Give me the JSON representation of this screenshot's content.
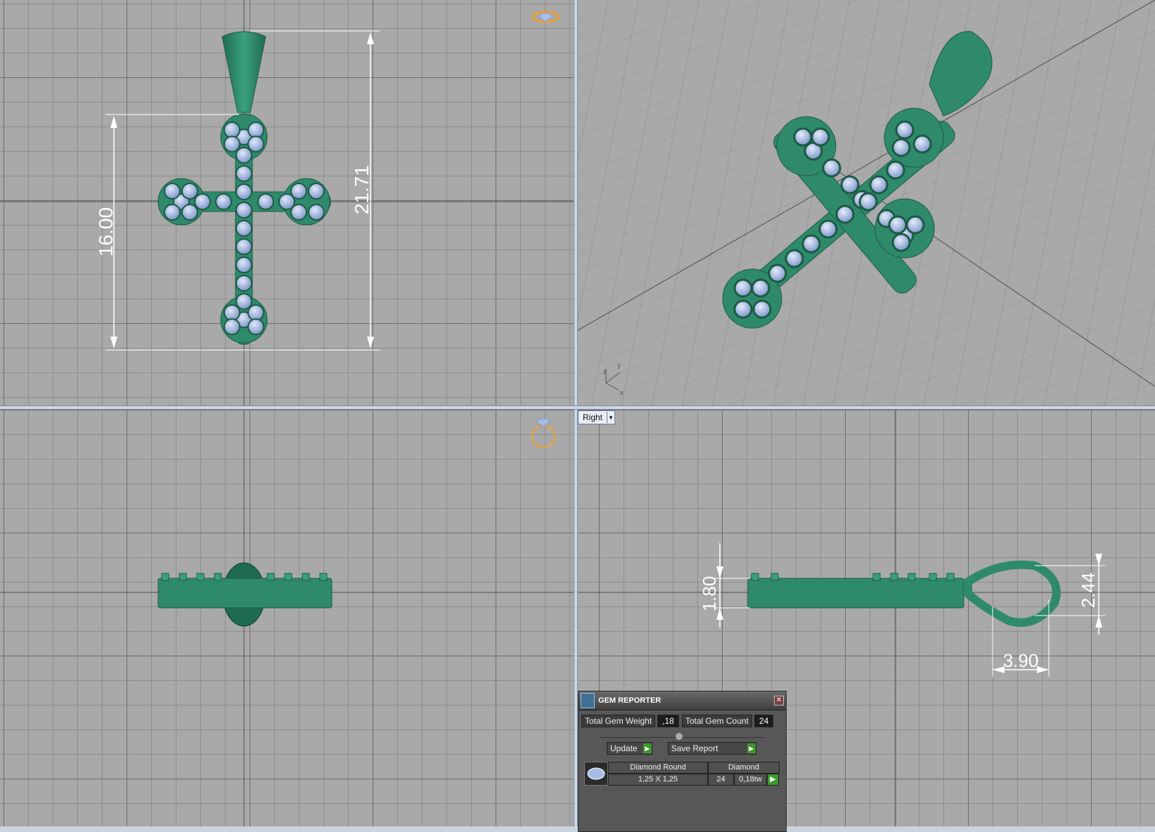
{
  "viewports": {
    "top": {
      "dimensions": [
        "16.00",
        "21.71"
      ]
    },
    "right": {
      "label": "Right",
      "dimensions": [
        "1.80",
        "2.44",
        "3.90"
      ]
    }
  },
  "axes": {
    "z": "z",
    "y": "y",
    "x": "x"
  },
  "gem_reporter": {
    "title": "GEM REPORTER",
    "total_weight_label": "Total Gem Weight",
    "total_weight_value": ",18",
    "total_count_label": "Total Gem Count",
    "total_count_value": "24",
    "update_label": "Update",
    "save_label": "Save Report",
    "table": {
      "shape_name": "Diamond Round",
      "material": "Diamond",
      "size": "1,25 X 1,25",
      "count": "24",
      "weight": "0,18tw"
    }
  },
  "colors": {
    "metal": "#2e8a6a",
    "gem": "#a8bde6",
    "dimension": "#ffffff",
    "accent": "#f0a030"
  },
  "icons": [
    "gem-view-icon",
    "ring-view-icon",
    "gem-reporter-icon",
    "close-icon",
    "dropdown-icon",
    "play-icon"
  ]
}
